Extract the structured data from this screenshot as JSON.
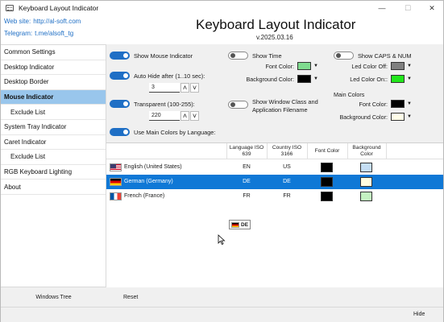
{
  "window": {
    "title": "Keyboard Layout Indicator"
  },
  "header": {
    "website_label": "Web site:",
    "website_value": "http://al-soft.com",
    "telegram_label": "Telegram:",
    "telegram_value": "t.me/alsoft_tg",
    "app_title": "Keyboard Layout Indicator",
    "version": "v.2025.03.16"
  },
  "sidebar": {
    "items": [
      {
        "label": "Common Settings"
      },
      {
        "label": "Desktop Indicator"
      },
      {
        "label": "Desktop Border"
      },
      {
        "label": "Mouse Indicator"
      },
      {
        "label": "Exclude List"
      },
      {
        "label": "System Tray Indicator"
      },
      {
        "label": "Caret Indicator"
      },
      {
        "label": "Exclude List"
      },
      {
        "label": "RGB Keyboard Lighting"
      },
      {
        "label": "About"
      }
    ],
    "footer": "Windows Tree"
  },
  "options": {
    "show_mouse_indicator": "Show Mouse Indicator",
    "auto_hide": "Auto Hide after (1..10 sec):",
    "auto_hide_value": "3",
    "transparent": "Transparent (100-255):",
    "transparent_value": "220",
    "use_main_colors": "Use Main Colors by Language:",
    "show_time": "Show Time",
    "font_color": "Font Color:",
    "background_color": "Background Color:",
    "show_window_class_1": "Show Window Class and",
    "show_window_class_2": "Application Filename",
    "show_caps_num": "Show CAPS & NUM",
    "led_color_off": "Led Color Off:",
    "led_color_on": "Led Color On::",
    "main_colors": "Main Colors",
    "main_font_color": "Font Color:",
    "main_background_color": "Background Color:"
  },
  "colors": {
    "accent": "#1f6fc5",
    "selection": "#0f78d6",
    "time_font": "#7fdc8f",
    "time_bg": "#000000",
    "led_off": "#808080",
    "led_on": "#22e61c",
    "main_font": "#000000",
    "main_bg": "#fffde8"
  },
  "table": {
    "headers": {
      "language_iso_1": "Language ISO",
      "language_iso_2": "639",
      "country_iso_1": "Country ISO",
      "country_iso_2": "3166",
      "font_color": "Font Color",
      "background_color_1": "Background",
      "background_color_2": "Color"
    },
    "rows": [
      {
        "language": "English (United States)",
        "lang_iso": "EN",
        "country_iso": "US",
        "font_color": "#000000",
        "bg_color": "#c5def5",
        "flag": "us-flag-icon"
      },
      {
        "language": "German (Germany)",
        "lang_iso": "DE",
        "country_iso": "DE",
        "font_color": "#000000",
        "bg_color": "#fffde0",
        "flag": "de-flag-icon"
      },
      {
        "language": "French (France)",
        "lang_iso": "FR",
        "country_iso": "FR",
        "font_color": "#000000",
        "bg_color": "#c4f2c2",
        "flag": "fr-flag-icon"
      }
    ],
    "selected_row": 1
  },
  "preview": {
    "text": "DE"
  },
  "footer": {
    "reset": "Reset",
    "hide": "Hide"
  }
}
